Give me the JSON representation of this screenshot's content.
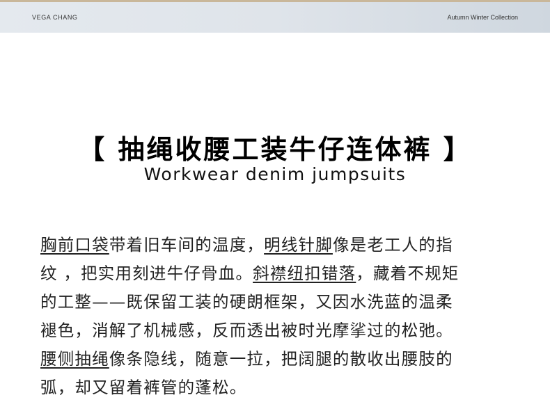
{
  "header": {
    "brand": "VEGA CHANG",
    "collection": "Autumn Winter Collection"
  },
  "title": "【 抽绳收腰工装牛仔连体裤 】",
  "subtitle": "Workwear denim jumpsuits",
  "body": {
    "l1a": "胸前口袋",
    "l1b": "带着旧车间的温度，",
    "l1c": "明线针脚",
    "l1d": "像是老工人的指",
    "l2a": "纹 ，把实用刻进牛仔骨血。",
    "l2b": "斜襟纽扣错落",
    "l2c": "，藏着不规矩",
    "l3": "的工整——既保留工装的硬朗框架，又因水洗蓝的温柔",
    "l4": "褪色，消解了机械感，反而透出被时光摩挲过的松弛。",
    "l5a": "腰侧抽绳",
    "l5b": "像条隐线，随意一拉，把阔腿的散收出腰肢的",
    "l6": "弧，却又留着裤管的蓬松。"
  }
}
